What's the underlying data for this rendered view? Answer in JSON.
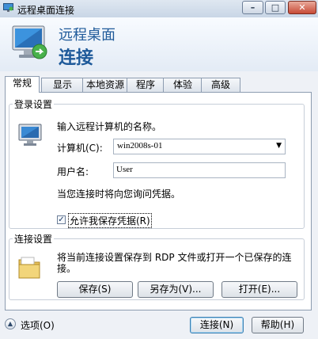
{
  "window": {
    "title": "远程桌面连接",
    "minimize_glyph": "–",
    "maximize_glyph": "□",
    "close_glyph": "✕"
  },
  "banner": {
    "line1": "远程桌面",
    "line2": "连接"
  },
  "tabs": [
    {
      "label": "常规",
      "active": true
    },
    {
      "label": "显示",
      "active": false
    },
    {
      "label": "本地资源",
      "active": false
    },
    {
      "label": "程序",
      "active": false
    },
    {
      "label": "体验",
      "active": false
    },
    {
      "label": "高级",
      "active": false
    }
  ],
  "login": {
    "legend": "登录设置",
    "prompt": "输入远程计算机的名称。",
    "computer_label": "计算机(C):",
    "computer_value": "win2008s-01",
    "username_label": "用户名:",
    "username_value": "User",
    "credential_note": "当您连接时将向您询问凭据。",
    "save_credentials_label": "允许我保存凭据(R)",
    "save_credentials_checked": true
  },
  "connection": {
    "legend": "连接设置",
    "description": "将当前连接设置保存到 RDP 文件或打开一个已保存的连接。",
    "save_button": "保存(S)",
    "save_as_button": "另存为(V)...",
    "open_button": "打开(E)..."
  },
  "footer": {
    "options_label": "选项(O)",
    "connect_button": "连接(N)",
    "help_button": "帮助(H)"
  },
  "colors": {
    "accent": "#1f5a9a",
    "titlebar": "#c9d6e6",
    "close": "#c74a36"
  }
}
